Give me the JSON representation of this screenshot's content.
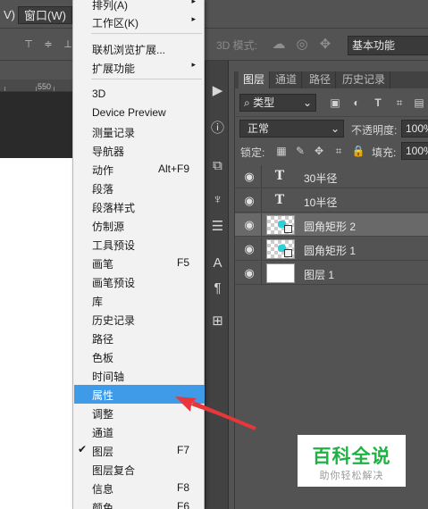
{
  "app": {
    "menubar": {
      "partial_menu": "V)",
      "window_menu": "窗口(W)"
    },
    "options_bar": {
      "mode_3d": "3D 模式:",
      "workspace": "基本功能"
    },
    "ruler": {
      "tick": "550"
    }
  },
  "menu": {
    "items": [
      {
        "label": "排列(A)",
        "submenu": true
      },
      {
        "label": "工作区(K)",
        "submenu": true
      },
      {
        "label": "联机浏览扩展..."
      },
      {
        "label": "扩展功能",
        "submenu": true
      },
      {
        "label": "3D"
      },
      {
        "label": "Device Preview"
      },
      {
        "label": "测量记录"
      },
      {
        "label": "导航器"
      },
      {
        "label": "动作",
        "shortcut": "Alt+F9"
      },
      {
        "label": "段落"
      },
      {
        "label": "段落样式"
      },
      {
        "label": "仿制源"
      },
      {
        "label": "工具预设"
      },
      {
        "label": "画笔",
        "shortcut": "F5"
      },
      {
        "label": "画笔预设"
      },
      {
        "label": "库"
      },
      {
        "label": "历史记录"
      },
      {
        "label": "路径"
      },
      {
        "label": "色板"
      },
      {
        "label": "时间轴"
      },
      {
        "label": "属性",
        "highlighted": true
      },
      {
        "label": "调整"
      },
      {
        "label": "通道"
      },
      {
        "label": "图层",
        "shortcut": "F7",
        "checked": true
      },
      {
        "label": "图层复合"
      },
      {
        "label": "信息",
        "shortcut": "F8"
      },
      {
        "label": "颜色",
        "shortcut": "F6"
      }
    ],
    "submenu_arrow": "▸",
    "check_mark": "✔",
    "highlight_color": "#3f9ae8"
  },
  "layers_panel": {
    "tabs": [
      "图层",
      "通道",
      "路径",
      "历史记录"
    ],
    "active_tab": "图层",
    "filter": {
      "label": "类型"
    },
    "blend_mode": "正常",
    "opacity_label": "不透明度:",
    "opacity_value": "100%",
    "lock_label": "锁定:",
    "fill_label": "填充:",
    "fill_value": "100%",
    "layers": [
      {
        "name": "30半径",
        "kind": "text"
      },
      {
        "name": "10半径",
        "kind": "text"
      },
      {
        "name": "圆角矩形 2",
        "kind": "shape",
        "selected": true
      },
      {
        "name": "圆角矩形 1",
        "kind": "shape"
      },
      {
        "name": "图层 1",
        "kind": "pixel"
      }
    ]
  },
  "watermark": {
    "title": "百科全说",
    "subtitle": "助你轻松解决"
  },
  "colors": {
    "arrow": "#e8373a",
    "ps_bg": "#535353"
  }
}
